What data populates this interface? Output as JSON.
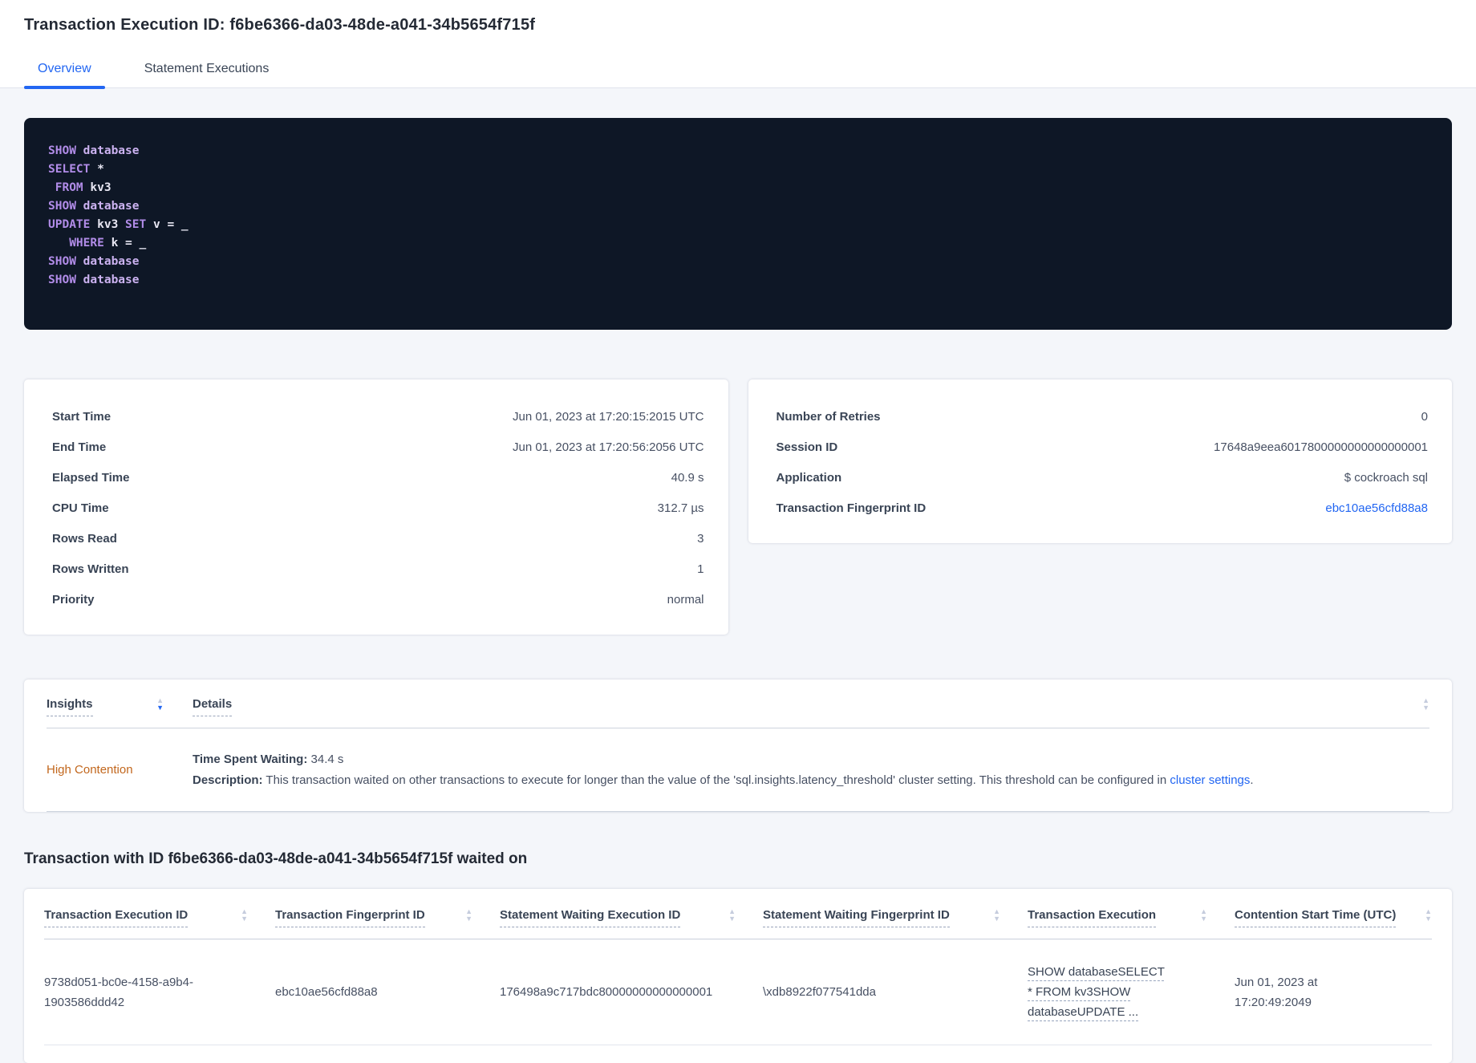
{
  "header": {
    "title": "Transaction Execution ID: f6be6366-da03-48de-a041-34b5654f715f"
  },
  "tabs": [
    {
      "label": "Overview",
      "active": true
    },
    {
      "label": "Statement Executions",
      "active": false
    }
  ],
  "sql": {
    "lines": [
      [
        {
          "t": "kw",
          "s": "SHOW"
        },
        {
          "t": "db",
          "s": " database"
        }
      ],
      [
        {
          "t": "kw",
          "s": "SELECT"
        },
        {
          "t": "pl",
          "s": " *"
        }
      ],
      [
        {
          "t": "pl",
          "s": " "
        },
        {
          "t": "kw",
          "s": "FROM"
        },
        {
          "t": "pl",
          "s": " kv3"
        }
      ],
      [
        {
          "t": "kw",
          "s": "SHOW"
        },
        {
          "t": "db",
          "s": " database"
        }
      ],
      [
        {
          "t": "kw",
          "s": "UPDATE"
        },
        {
          "t": "pl",
          "s": " kv3 "
        },
        {
          "t": "kw",
          "s": "SET"
        },
        {
          "t": "pl",
          "s": " v = _"
        }
      ],
      [
        {
          "t": "pl",
          "s": "   "
        },
        {
          "t": "kw",
          "s": "WHERE"
        },
        {
          "t": "pl",
          "s": " k = _"
        }
      ],
      [
        {
          "t": "kw",
          "s": "SHOW"
        },
        {
          "t": "db",
          "s": " database"
        }
      ],
      [
        {
          "t": "kw",
          "s": "SHOW"
        },
        {
          "t": "db",
          "s": " database"
        }
      ]
    ]
  },
  "left_card": {
    "rows": [
      {
        "label": "Start Time",
        "value": "Jun 01, 2023 at 17:20:15:2015 UTC"
      },
      {
        "label": "End Time",
        "value": "Jun 01, 2023 at 17:20:56:2056 UTC"
      },
      {
        "label": "Elapsed Time",
        "value": "40.9 s"
      },
      {
        "label": "CPU Time",
        "value": "312.7 µs"
      },
      {
        "label": "Rows Read",
        "value": "3"
      },
      {
        "label": "Rows Written",
        "value": "1"
      },
      {
        "label": "Priority",
        "value": "normal"
      }
    ]
  },
  "right_card": {
    "rows": [
      {
        "label": "Number of Retries",
        "value": "0"
      },
      {
        "label": "Session ID",
        "value": "17648a9eea6017800000000000000001"
      },
      {
        "label": "Application",
        "value": "$ cockroach sql"
      },
      {
        "label": "Transaction Fingerprint ID",
        "value": "ebc10ae56cfd88a8",
        "link": true
      }
    ]
  },
  "insights": {
    "columns": {
      "insights_label": "Insights",
      "details_label": "Details"
    },
    "row": {
      "insight": "High Contention",
      "waiting_label": "Time Spent Waiting:",
      "waiting_value": " 34.4 s",
      "description_label": "Description:",
      "description_text": " This transaction waited on other transactions to execute for longer than the value of the 'sql.insights.latency_threshold' cluster setting. This threshold can be configured in ",
      "description_link": "cluster settings",
      "description_suffix": "."
    }
  },
  "waited_on": {
    "heading": "Transaction with ID f6be6366-da03-48de-a041-34b5654f715f waited on",
    "columns": [
      "Transaction Execution ID",
      "Transaction Fingerprint ID",
      "Statement Waiting Execution ID",
      "Statement Waiting Fingerprint ID",
      "Transaction Execution",
      "Contention Start Time (UTC)"
    ],
    "rows": [
      {
        "transaction_execution_id": "9738d051-bc0e-4158-a9b4-1903586ddd42",
        "transaction_fingerprint_id": "ebc10ae56cfd88a8",
        "statement_waiting_execution_id": "176498a9c717bdc80000000000000001",
        "statement_waiting_fingerprint_id": "\\xdb8922f077541dda",
        "transaction_execution": "SHOW databaseSELECT * FROM kv3SHOW databaseUPDATE ...",
        "contention_start_time": "Jun 01, 2023 at 17:20:49:2049"
      }
    ]
  },
  "icons": {
    "sort_asc": "▲",
    "sort_desc": "▼"
  },
  "colors": {
    "accent_blue": "#2266f2",
    "warning_orange": "#c2671d",
    "code_background": "#0e1726",
    "code_keyword": "#b18ce8",
    "code_keyword_light": "#cbb2f0",
    "code_plain": "#e7e6f2",
    "page_background": "#f4f6fa"
  }
}
